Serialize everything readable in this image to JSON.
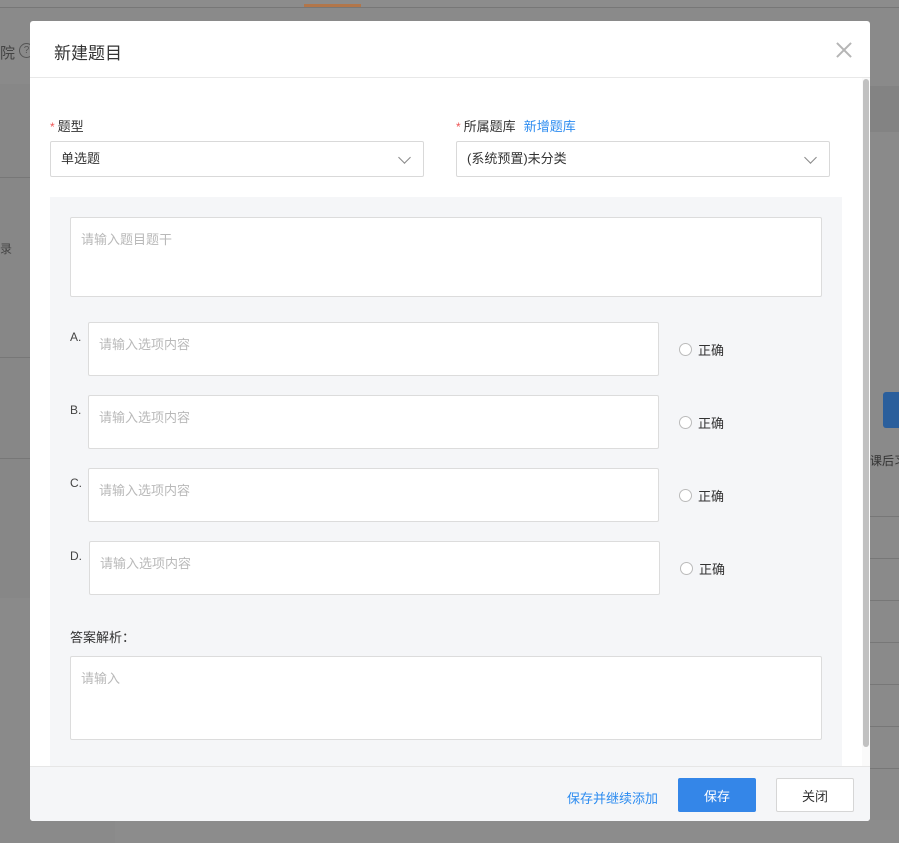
{
  "background": {
    "left_text": "院",
    "help_glyph": "?",
    "left_glyph": "录",
    "right_text": "课后习"
  },
  "modal": {
    "title": "新建题目",
    "close_icon": "close-icon"
  },
  "form": {
    "required_mark": "*",
    "type": {
      "label": "题型",
      "value": "单选题"
    },
    "bank": {
      "label": "所属题库",
      "add_link": "新增题库",
      "value": "(系统预置)未分类"
    },
    "stem_placeholder": "请输入题目题干",
    "options": [
      {
        "letter": "A.",
        "placeholder": "请输入选项内容",
        "correct_label": "正确"
      },
      {
        "letter": "B.",
        "placeholder": "请输入选项内容",
        "correct_label": "正确"
      },
      {
        "letter": "C.",
        "placeholder": "请输入选项内容",
        "correct_label": "正确"
      },
      {
        "letter": "D.",
        "placeholder": "请输入选项内容",
        "correct_label": "正确"
      }
    ],
    "analysis": {
      "label": "答案解析：",
      "placeholder": "请输入"
    }
  },
  "footer": {
    "save_continue": "保存并继续添加",
    "save": "保存",
    "close": "关闭"
  },
  "colors": {
    "primary": "#3486e8",
    "link": "#2d8cf0",
    "required": "#e55555"
  }
}
